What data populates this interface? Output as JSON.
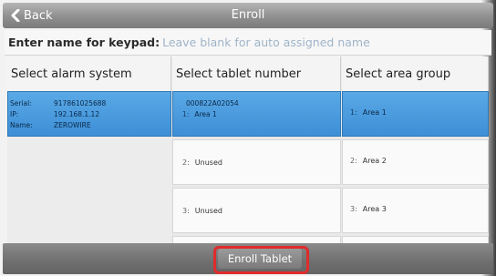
{
  "header": {
    "back_label": "Back",
    "title": "Enroll",
    "back_icon": "chevron-left-icon"
  },
  "name_row": {
    "label": "Enter name for keypad:",
    "placeholder": "Leave blank for auto assigned name",
    "value": ""
  },
  "columns": {
    "alarm_system": "Select alarm system",
    "tablet_number": "Select tablet number",
    "area_group": "Select area group"
  },
  "alarm_system": {
    "serial_key": "Serial:",
    "serial_val": "917861025688",
    "ip_key": "IP:",
    "ip_val": "192.168.1.12",
    "name_key": "Name:",
    "name_val": "ZEROWIRE"
  },
  "tablets": [
    {
      "index": "1:",
      "line1": "000822A02054",
      "line2": "Area 1"
    },
    {
      "index": "2:",
      "label": "Unused"
    },
    {
      "index": "3:",
      "label": "Unused"
    }
  ],
  "area_groups": [
    {
      "index": "1:",
      "label": "Area 1"
    },
    {
      "index": "2:",
      "label": "Area 2"
    },
    {
      "index": "3:",
      "label": "Area 3"
    }
  ],
  "footer": {
    "enroll_label": "Enroll Tablet"
  },
  "colors": {
    "selection": "#3d8fd6",
    "highlight": "#e02b2b",
    "bar": "#7b7b7b"
  }
}
